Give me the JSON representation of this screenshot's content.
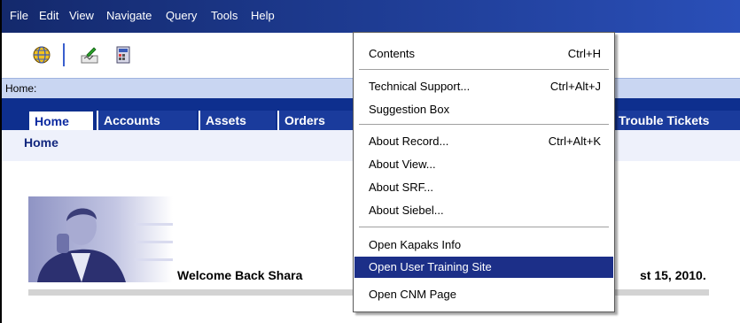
{
  "menubar": {
    "items": [
      "File",
      "Edit",
      "View",
      "Navigate",
      "Query",
      "Tools",
      "Help"
    ]
  },
  "toolbar": {
    "icons": [
      "globe-icon",
      "signature-icon",
      "calculator-icon"
    ]
  },
  "addressbar": {
    "label": "Home:"
  },
  "tabs": {
    "items": [
      "Home",
      "Accounts",
      "Assets",
      "Orders",
      "Trouble Tickets"
    ],
    "active": "Home"
  },
  "subbar": {
    "crumb": "Home"
  },
  "welcome": {
    "visible_text": "Welcome Back Shara",
    "tail_text": "st 15, 2010."
  },
  "help_menu": {
    "items": [
      {
        "label": "Contents",
        "shortcut": "Ctrl+H"
      },
      {
        "label": "Technical Support...",
        "shortcut": "Ctrl+Alt+J"
      },
      {
        "label": "Suggestion Box",
        "shortcut": ""
      },
      {
        "label": "About Record...",
        "shortcut": "Ctrl+Alt+K"
      },
      {
        "label": "About View...",
        "shortcut": ""
      },
      {
        "label": "About SRF...",
        "shortcut": ""
      },
      {
        "label": "About Siebel...",
        "shortcut": ""
      },
      {
        "label": "Open Kapaks Info",
        "shortcut": ""
      },
      {
        "label": "Open User Training Site",
        "shortcut": ""
      },
      {
        "label": "Open CNM Page",
        "shortcut": ""
      }
    ],
    "highlighted": "Open User Training Site"
  },
  "colors": {
    "menubar": "#1d3a8f",
    "tabstrip": "#0e2f8e",
    "highlight": "#1c2f88",
    "addressbar": "#c9d6f2"
  }
}
